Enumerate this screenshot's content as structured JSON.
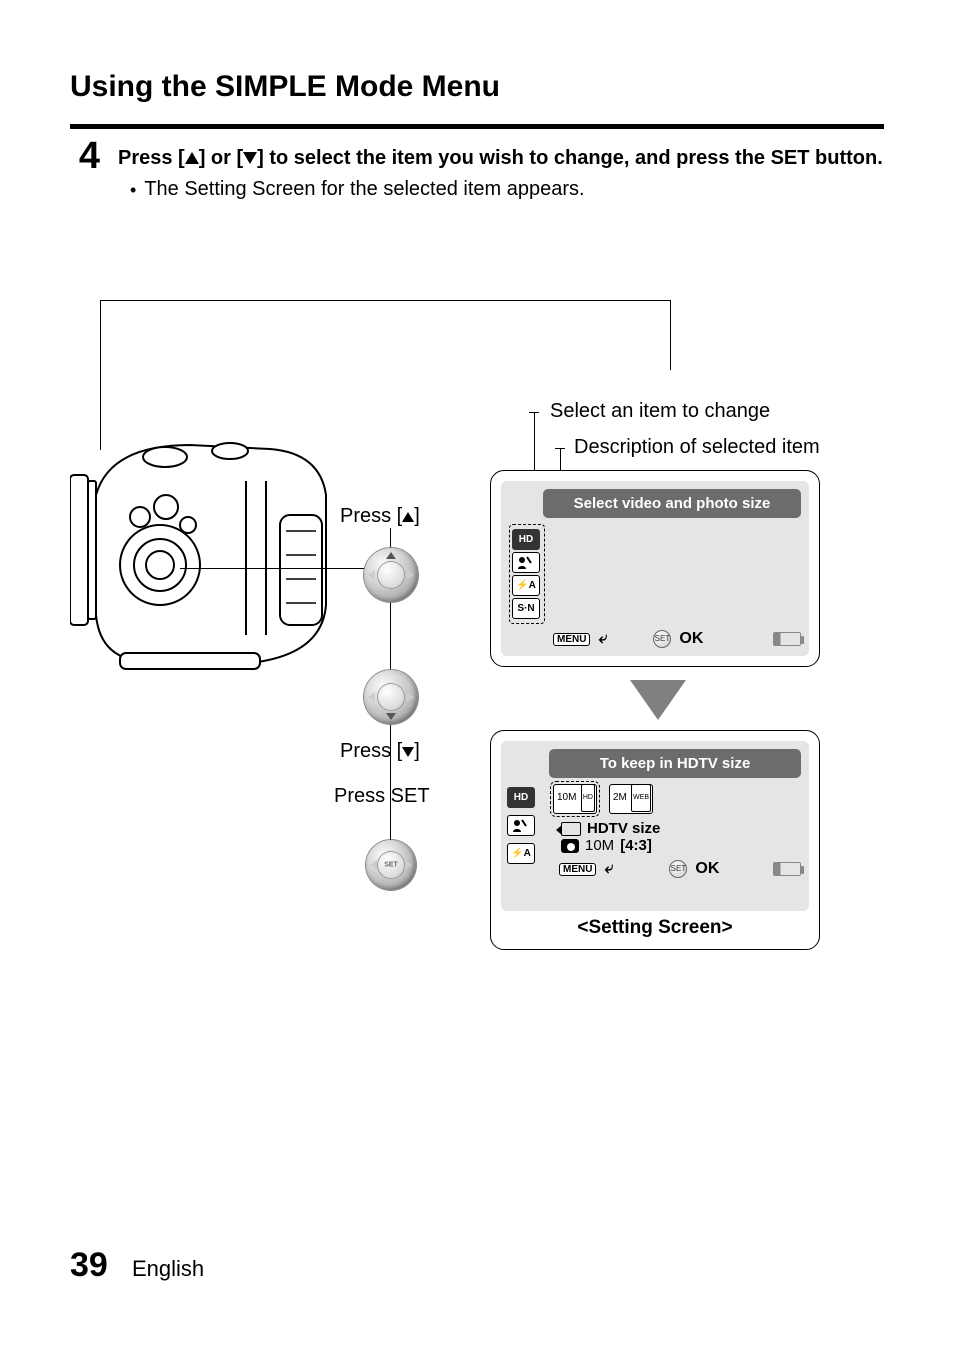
{
  "title": "Using the SIMPLE Mode Menu",
  "step": {
    "number": "4",
    "instruction_pre": "Press [",
    "instruction_mid": "] or [",
    "instruction_post": "] to select the item you wish to change, and press the SET button.",
    "bullet": "The Setting Screen for the selected item appears."
  },
  "callouts": {
    "select_item": "Select an item to change",
    "description": "Description of selected item",
    "press_up_pre": "Press [",
    "press_up_post": "]",
    "press_down_pre": "Press [",
    "press_down_post": "]",
    "press_set": "Press SET"
  },
  "screen1": {
    "banner": "Select video and photo size",
    "opts": [
      "HD",
      "",
      "⚡A",
      "S·N"
    ],
    "menu": "MENU",
    "ok": "OK"
  },
  "screen2": {
    "banner": "To keep in HDTV size",
    "opts": [
      "HD",
      "",
      "⚡A"
    ],
    "thumb1": "10M",
    "thumb1_sub": "HD",
    "thumb2": "2M",
    "thumb2_sub": "WEB",
    "line1": "HDTV size",
    "line2a": "10M",
    "line2b": "[4:3]",
    "menu": "MENU",
    "ok": "OK",
    "caption": "<Setting Screen>"
  },
  "footer": {
    "page": "39",
    "lang": "English"
  }
}
